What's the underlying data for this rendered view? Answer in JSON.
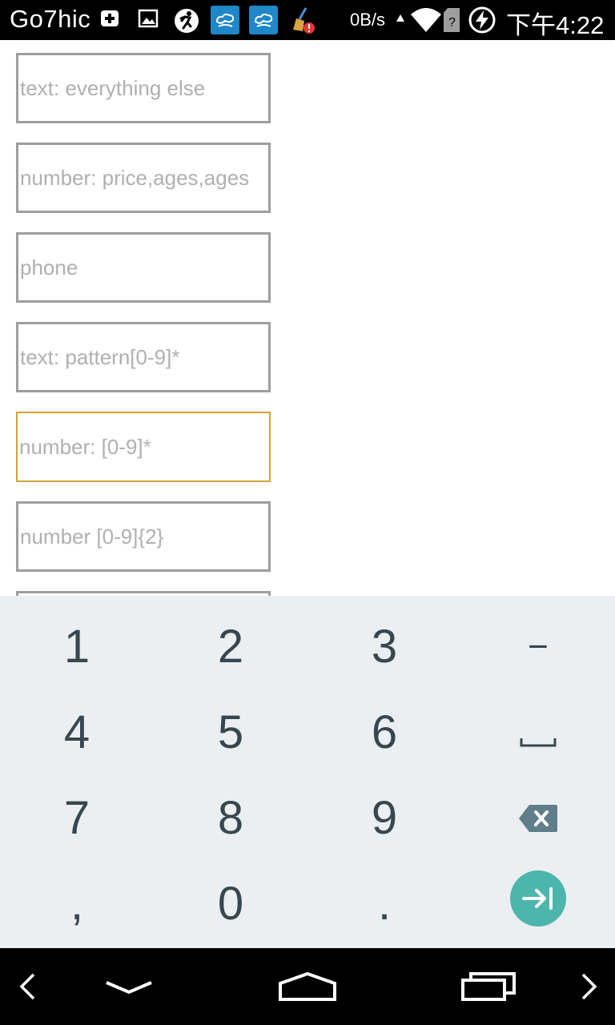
{
  "status_bar": {
    "carrier": "Go7hic",
    "net_speed": "0B/s",
    "time": "下午4:22",
    "icons": [
      "add-box-icon",
      "image-icon",
      "running-man-icon",
      "weather-cloud-icon",
      "weather-cloud-icon",
      "cleaner-broom-icon",
      "wifi-icon",
      "sim-card-icon",
      "battery-charging-icon"
    ]
  },
  "fields": [
    {
      "placeholder": "text: everything else",
      "value": ""
    },
    {
      "placeholder": "number: price,ages,ages",
      "value": ""
    },
    {
      "placeholder": "phone",
      "value": ""
    },
    {
      "placeholder": "text: pattern[0-9]*",
      "value": ""
    },
    {
      "placeholder": "number: [0-9]*",
      "value": "",
      "focused": true
    },
    {
      "placeholder": "number [0-9]{2}",
      "value": ""
    }
  ],
  "keyboard": {
    "rows": [
      [
        "1",
        "2",
        "3",
        "-"
      ],
      [
        "4",
        "5",
        "6",
        "space"
      ],
      [
        "7",
        "8",
        "9",
        "backspace"
      ],
      [
        ",",
        "0",
        ".",
        "next"
      ]
    ],
    "labels": {
      "k1": "1",
      "k2": "2",
      "k3": "3",
      "kminus": "−",
      "k4": "4",
      "k5": "5",
      "k6": "6",
      "k7": "7",
      "k8": "8",
      "k9": "9",
      "kcomma": ",",
      "k0": "0",
      "kdot": "."
    },
    "accent_color": "#4db6ac"
  },
  "nav_bar": {
    "buttons": [
      "back-arrow-icon",
      "hide-keyboard-icon",
      "home-icon",
      "recents-icon",
      "forward-arrow-icon"
    ]
  }
}
